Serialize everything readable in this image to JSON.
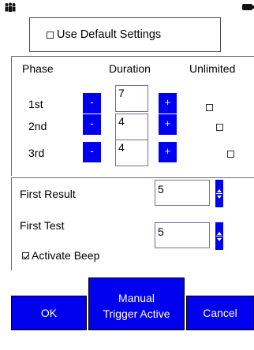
{
  "status": {
    "left_icon": "people-icon",
    "right_icon": "battery-icon"
  },
  "default_settings": {
    "label": "Use Default Settings",
    "checked": false
  },
  "phases": {
    "headers": {
      "phase": "Phase",
      "duration": "Duration",
      "unlimited": "Unlimited"
    },
    "rows": [
      {
        "label": "1st",
        "duration": "7",
        "unlimited": false
      },
      {
        "label": "2nd",
        "duration": "4",
        "unlimited": false
      },
      {
        "label": "3rd",
        "duration": "4",
        "unlimited": false
      }
    ],
    "minus_label": "-",
    "plus_label": "+"
  },
  "first_result": {
    "label": "First Result",
    "value": "5"
  },
  "first_test": {
    "label": "First Test",
    "value": "5"
  },
  "activate_beep": {
    "label": "Activate Beep",
    "checked": true
  },
  "buttons": {
    "ok": "OK",
    "manual_line1": "Manual",
    "manual_line2": "Trigger Active",
    "cancel": "Cancel"
  },
  "colors": {
    "accent": "#0000ee",
    "border": "#6e6e6e"
  }
}
